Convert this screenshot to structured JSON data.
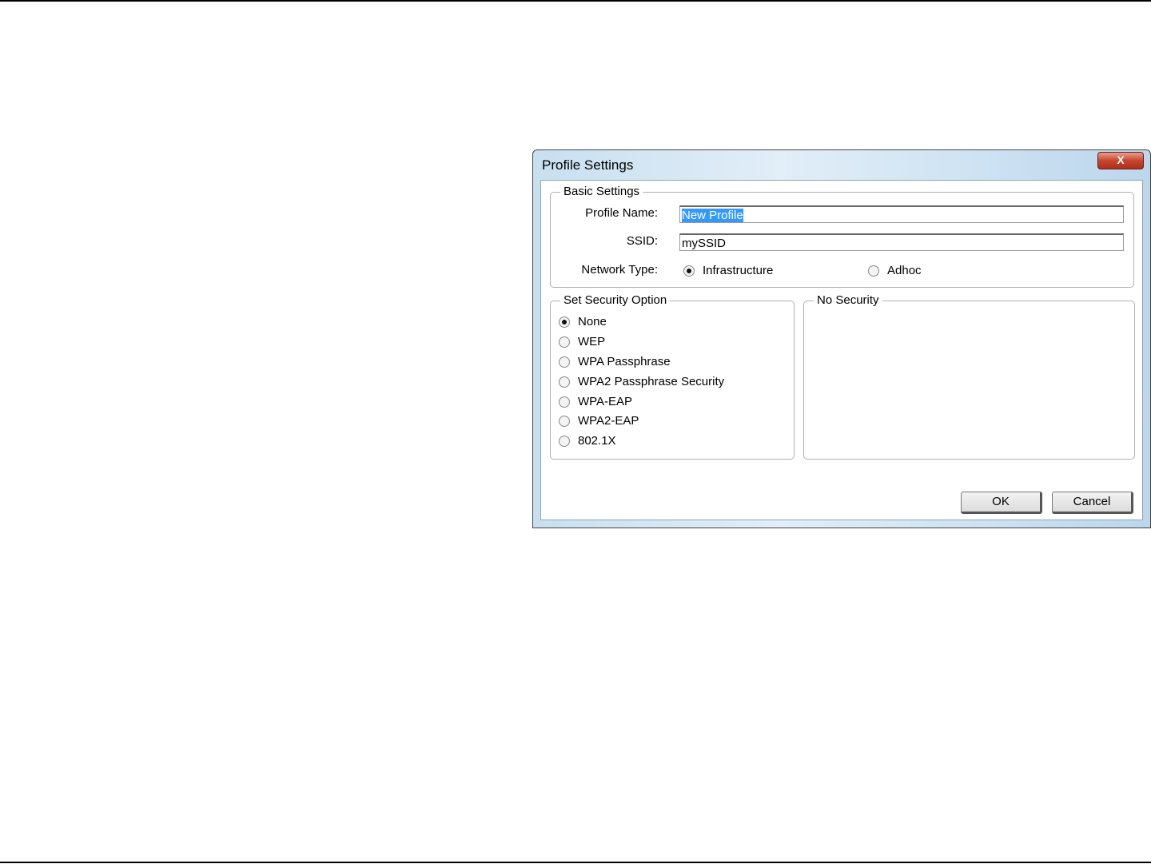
{
  "dialog": {
    "title": "Profile Settings",
    "close_label": "X",
    "basic": {
      "legend": "Basic Settings",
      "profile_name_label": "Profile Name:",
      "profile_name_value": "New Profile",
      "ssid_label": "SSID:",
      "ssid_value": "mySSID",
      "network_type_label": "Network Type:",
      "options": [
        {
          "label": "Infrastructure",
          "checked": true
        },
        {
          "label": "Adhoc",
          "checked": false
        }
      ]
    },
    "security": {
      "legend": "Set Security Option",
      "options": [
        {
          "label": "None",
          "checked": true
        },
        {
          "label": "WEP"
        },
        {
          "label": "WPA Passphrase"
        },
        {
          "label": "WPA2 Passphrase Security"
        },
        {
          "label": "WPA-EAP"
        },
        {
          "label": "WPA2-EAP"
        },
        {
          "label": "802.1X"
        }
      ]
    },
    "detail": {
      "legend": "No Security"
    },
    "ok_label": "OK",
    "cancel_label": "Cancel"
  }
}
